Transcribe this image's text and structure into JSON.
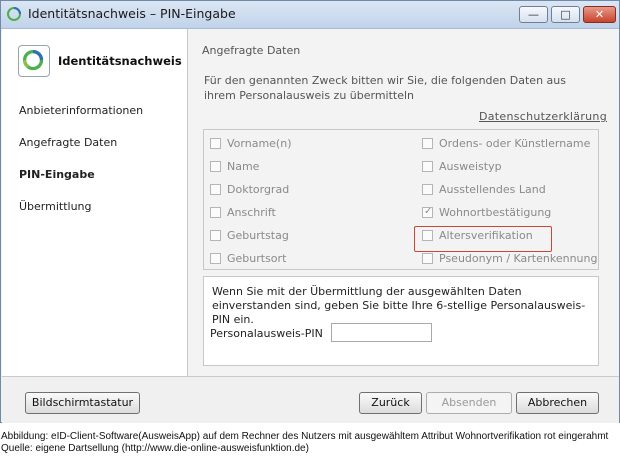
{
  "window": {
    "title": "Identitätsnachweis – PIN-Eingabe",
    "controls": {
      "minimize": "—",
      "maximize": "□",
      "close": "✕"
    }
  },
  "sidebar": {
    "brand": "Identitätsnachweis",
    "items": [
      {
        "label": "Anbieterinformationen",
        "active": false
      },
      {
        "label": "Angefragte Daten",
        "active": false
      },
      {
        "label": "PIN-Eingabe",
        "active": true
      },
      {
        "label": "Übermittlung",
        "active": false
      }
    ]
  },
  "content": {
    "heading": "Angefragte Daten",
    "intro": "Für den genannten Zweck bitten wir Sie, die folgenden Daten aus ihrem Personalausweis zu übermitteln",
    "privacy_link": "Datenschutzerklärung",
    "attributes_left": [
      {
        "label": "Vorname(n)",
        "checked": false
      },
      {
        "label": "Name",
        "checked": false
      },
      {
        "label": "Doktorgrad",
        "checked": false
      },
      {
        "label": "Anschrift",
        "checked": false
      },
      {
        "label": "Geburtstag",
        "checked": false
      },
      {
        "label": "Geburtsort",
        "checked": false
      }
    ],
    "attributes_right": [
      {
        "label": "Ordens- oder Künstlername",
        "checked": false
      },
      {
        "label": "Ausweistyp",
        "checked": false
      },
      {
        "label": "Ausstellendes Land",
        "checked": false
      },
      {
        "label": "Wohnortbestätigung",
        "checked": true
      },
      {
        "label": "Altersverifikation",
        "checked": false
      },
      {
        "label": "Pseudonym / Kartenkennung",
        "checked": false
      }
    ],
    "pin_prompt": "Wenn Sie mit der Übermittlung der ausgewählten Daten einverstanden sind, geben Sie bitte Ihre 6-stellige Personalausweis-PIN ein.",
    "pin_label": "Personalausweis-PIN",
    "pin_value": ""
  },
  "footer": {
    "keyboard_label": "Bildschirmtastatur",
    "back_label": "Zurück",
    "submit_label": "Absenden",
    "cancel_label": "Abbrechen"
  },
  "caption": {
    "line1": "Abbildung: eID-Client-Software(AusweisApp) auf dem Rechner des Nutzers mit ausgewähltem Attribut Wohnortverifikation rot eingerahmt",
    "line2": "Quelle: eigene Dartsellung (http://www.die-online-ausweisfunktion.de)"
  },
  "colors": {
    "highlight": "#c7473a",
    "logo_green": "#4caf50",
    "logo_blue": "#2e6fb5"
  }
}
